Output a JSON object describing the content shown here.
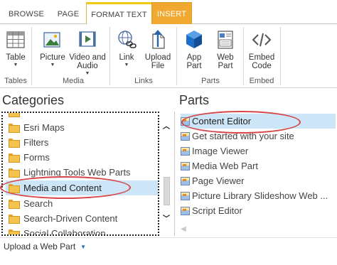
{
  "tabs": {
    "browse": "BROWSE",
    "page": "PAGE",
    "format_text": "FORMAT TEXT",
    "insert": "INSERT"
  },
  "ribbon": {
    "table_label": "Table",
    "tables_group": "Tables",
    "picture_label": "Picture",
    "video_audio_line1": "Video and",
    "video_audio_line2": "Audio",
    "media_group": "Media",
    "link_label": "Link",
    "upload_file_line1": "Upload",
    "upload_file_line2": "File",
    "links_group": "Links",
    "app_part_line1": "App",
    "app_part_line2": "Part",
    "web_part_line1": "Web",
    "web_part_line2": "Part",
    "parts_group": "Parts",
    "embed_code_line1": "Embed",
    "embed_code_line2": "Code",
    "embed_group": "Embed"
  },
  "categories": {
    "title": "Categories",
    "items": [
      "Esri Maps",
      "Filters",
      "Forms",
      "Lightning Tools Web Parts",
      "Media and Content",
      "Search",
      "Search-Driven Content",
      "Social Collaboration"
    ],
    "selected": "Media and Content"
  },
  "parts": {
    "title": "Parts",
    "items": [
      "Content Editor",
      "Get started with your site",
      "Image Viewer",
      "Media Web Part",
      "Page Viewer",
      "Picture Library Slideshow Web ...",
      "Script Editor"
    ],
    "selected": "Content Editor"
  },
  "upload": {
    "label": "Upload a Web Part"
  },
  "colors": {
    "insert_tab": "#f0a830",
    "selection": "#cde6f7",
    "highlight_ellipse": "#d6454a",
    "accent_blue": "#1d6fb5"
  }
}
